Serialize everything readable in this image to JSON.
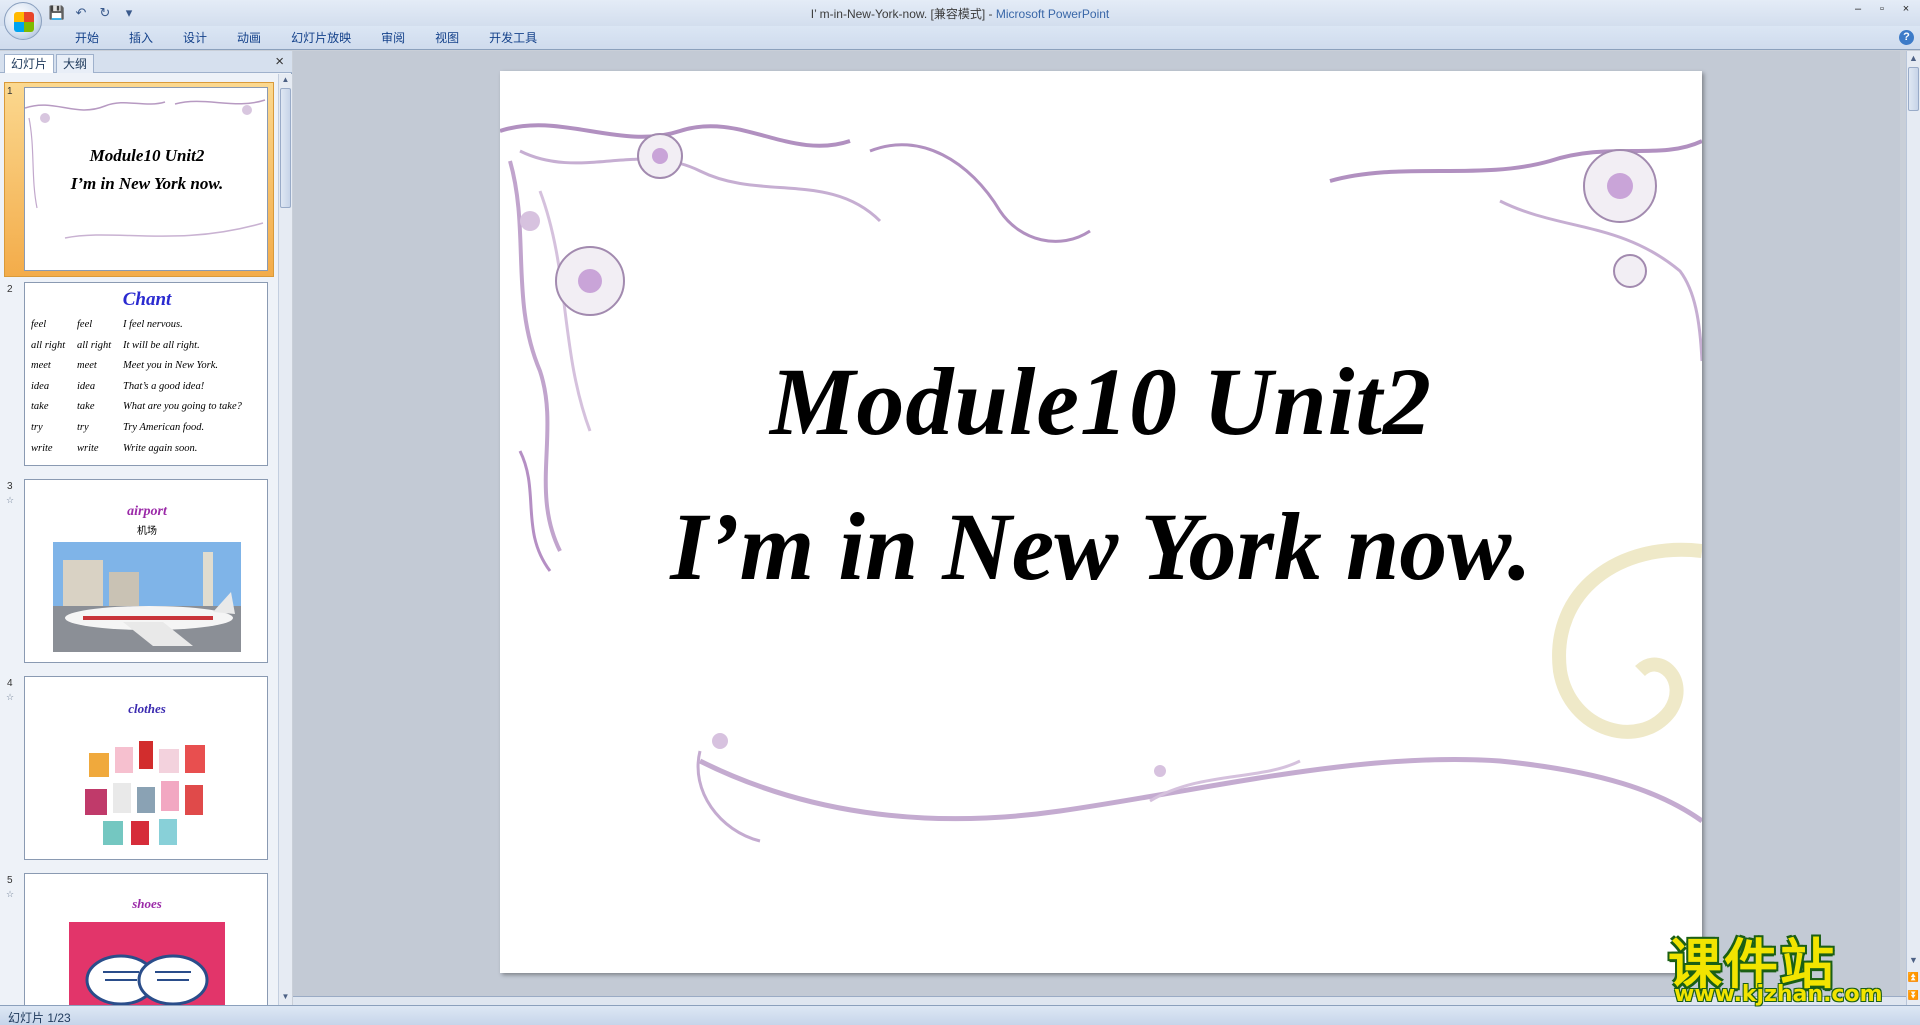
{
  "titlebar": {
    "doc_title": "I’ m-in-New-York-now. [兼容模式]",
    "separator": " - ",
    "app_name": "Microsoft PowerPoint",
    "minimize": "–",
    "restore": "▫",
    "close": "×",
    "qat_save": "💾",
    "qat_undo": "↶",
    "qat_redo": "↻",
    "qat_more": "▾"
  },
  "ribbon": {
    "tabs": [
      "开始",
      "插入",
      "设计",
      "动画",
      "幻灯片放映",
      "审阅",
      "视图",
      "开发工具"
    ],
    "help": "?"
  },
  "panel": {
    "tab_slides": "幻灯片",
    "tab_outline": "大纲",
    "close": "×"
  },
  "thumbnails": [
    {
      "num": "1",
      "line1": "Module10 Unit2",
      "line2": "I’m in New York now."
    },
    {
      "num": "2",
      "title": "Chant",
      "rows": [
        [
          "feel",
          "feel",
          "I  feel  nervous."
        ],
        [
          "all right",
          "all right",
          "It  will  be  all  right."
        ],
        [
          "meet",
          "meet",
          "Meet  you  in  New  York."
        ],
        [
          "idea",
          "idea",
          "That’s  a  good  idea!"
        ],
        [
          "take",
          "take",
          "What are you going to take?"
        ],
        [
          "try",
          "try",
          "Try  American  food."
        ],
        [
          "write",
          "write",
          "Write  again  soon."
        ]
      ]
    },
    {
      "num": "3",
      "star": "☆",
      "word": "airport",
      "cn": "机场"
    },
    {
      "num": "4",
      "star": "☆",
      "word": "clothes"
    },
    {
      "num": "5",
      "star": "☆",
      "word": "shoes"
    }
  ],
  "slide": {
    "title_line1": "Module10 Unit2",
    "title_line2": "I’m in New York now."
  },
  "status": {
    "slide_counter": "幻灯片 1/23"
  },
  "watermark": {
    "cn": "课件站",
    "url": "www.kjzhan.com"
  },
  "colors": {
    "ribbon_text": "#15428b",
    "app_name": "#3967a8",
    "chant_title": "#2a2ad0",
    "word_purple": "#9b2aa8"
  }
}
